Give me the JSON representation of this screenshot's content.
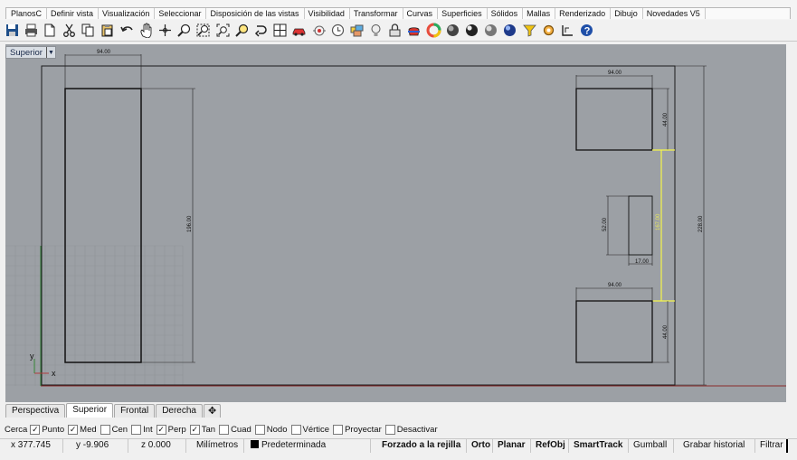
{
  "menu_tabs": [
    "PlanosC",
    "Definir vista",
    "Visualización",
    "Seleccionar",
    "Disposición de las vistas",
    "Visibilidad",
    "Transformar",
    "Curvas",
    "Superficies",
    "Sólidos",
    "Mallas",
    "Renderizado",
    "Dibujo",
    "Novedades V5"
  ],
  "toolbar_icons": [
    "save-icon",
    "print-icon",
    "open-icon",
    "cut-icon",
    "copy-icon",
    "paste-icon",
    "undo-icon",
    "pan-hand-icon",
    "rotate-view-icon",
    "zoom-window-icon",
    "zoom-dynamic-icon",
    "zoom-extents-icon",
    "zoom-selected-icon",
    "rotate-icon",
    "four-viewports-icon",
    "car-icon",
    "camera-target-icon",
    "clock-icon",
    "layers-icon",
    "light-bulb-icon",
    "lock-icon",
    "render-teapot-icon",
    "color-wheel-icon",
    "shaded-sphere-icon",
    "rendered-sphere-icon",
    "ghosted-sphere-icon",
    "blue-sphere-icon",
    "select-filter-icon",
    "options-gear-icon",
    "coordinate-axes-icon",
    "help-icon"
  ],
  "viewport": {
    "title": "Superior",
    "dropdown_glyph": "▼",
    "axis_y": "y",
    "axis_x": "x",
    "dims": [
      "94.00",
      "196.00",
      "94.00",
      "44.00",
      "52.00",
      "17.00",
      "167.00",
      "94.00",
      "44.00",
      "228.00"
    ]
  },
  "view_tabs": [
    {
      "label": "Perspectiva",
      "active": false
    },
    {
      "label": "Superior",
      "active": true
    },
    {
      "label": "Frontal",
      "active": false
    },
    {
      "label": "Derecha",
      "active": false
    }
  ],
  "add_view_glyph": "✥",
  "osnap": {
    "lead": "Cerca",
    "items": [
      {
        "label": "Punto",
        "checked": true
      },
      {
        "label": "Med",
        "checked": true
      },
      {
        "label": "Cen",
        "checked": false
      },
      {
        "label": "Int",
        "checked": false
      },
      {
        "label": "Perp",
        "checked": true
      },
      {
        "label": "Tan",
        "checked": true
      },
      {
        "label": "Cuad",
        "checked": false
      },
      {
        "label": "Nodo",
        "checked": false
      },
      {
        "label": "Vértice",
        "checked": false
      },
      {
        "label": "Proyectar",
        "checked": false
      },
      {
        "label": "Desactivar",
        "checked": false
      }
    ]
  },
  "status": {
    "x": "x 377.745",
    "y": "y -9.906",
    "z": "z 0.000",
    "units": "Milímetros",
    "layer": "Predeterminada",
    "grid_snap": "Forzado a la rejilla",
    "ortho": "Orto",
    "planar": "Planar",
    "osnap": "RefObj",
    "smarttrack": "SmartTrack",
    "gumball": "Gumball",
    "history": "Grabar historial",
    "filter": "Filtrar"
  }
}
